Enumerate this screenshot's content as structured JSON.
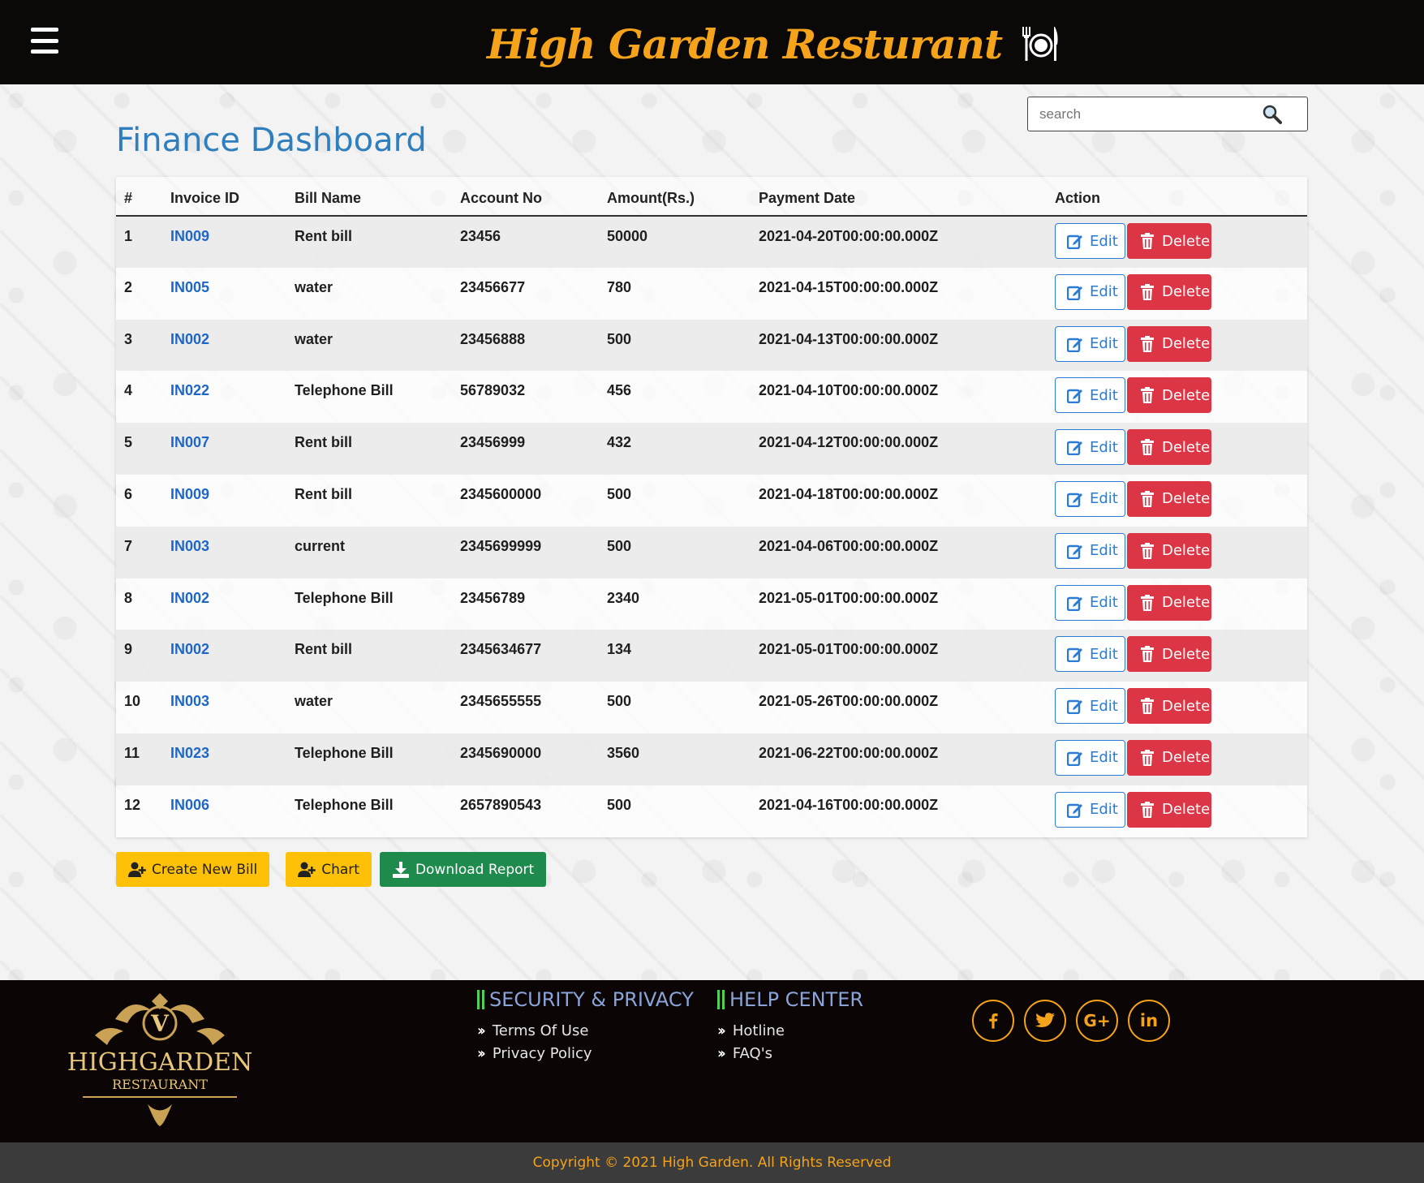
{
  "header": {
    "brand_title": "High Garden Resturant"
  },
  "search": {
    "placeholder": "search"
  },
  "page_title": "Finance Dashboard",
  "table": {
    "columns": [
      "#",
      "Invoice ID",
      "Bill Name",
      "Account No",
      "Amount(Rs.)",
      "Payment Date",
      "Action"
    ],
    "rows": [
      {
        "n": "1",
        "invoice": "IN009",
        "bill": "Rent bill",
        "account": "23456",
        "amount": "50000",
        "date": "2021-04-20T00:00:00.000Z"
      },
      {
        "n": "2",
        "invoice": "IN005",
        "bill": "water",
        "account": "23456677",
        "amount": "780",
        "date": "2021-04-15T00:00:00.000Z"
      },
      {
        "n": "3",
        "invoice": "IN002",
        "bill": "water",
        "account": "23456888",
        "amount": "500",
        "date": "2021-04-13T00:00:00.000Z"
      },
      {
        "n": "4",
        "invoice": "IN022",
        "bill": "Telephone Bill",
        "account": "56789032",
        "amount": "456",
        "date": "2021-04-10T00:00:00.000Z"
      },
      {
        "n": "5",
        "invoice": "IN007",
        "bill": "Rent bill",
        "account": "23456999",
        "amount": "432",
        "date": "2021-04-12T00:00:00.000Z"
      },
      {
        "n": "6",
        "invoice": "IN009",
        "bill": "Rent bill",
        "account": "2345600000",
        "amount": "500",
        "date": "2021-04-18T00:00:00.000Z"
      },
      {
        "n": "7",
        "invoice": "IN003",
        "bill": "current",
        "account": "2345699999",
        "amount": "500",
        "date": "2021-04-06T00:00:00.000Z"
      },
      {
        "n": "8",
        "invoice": "IN002",
        "bill": "Telephone Bill",
        "account": "23456789",
        "amount": "2340",
        "date": "2021-05-01T00:00:00.000Z"
      },
      {
        "n": "9",
        "invoice": "IN002",
        "bill": "Rent bill",
        "account": "2345634677",
        "amount": "134",
        "date": "2021-05-01T00:00:00.000Z"
      },
      {
        "n": "10",
        "invoice": "IN003",
        "bill": "water",
        "account": "2345655555",
        "amount": "500",
        "date": "2021-05-26T00:00:00.000Z"
      },
      {
        "n": "11",
        "invoice": "IN023",
        "bill": "Telephone Bill",
        "account": "2345690000",
        "amount": "3560",
        "date": "2021-06-22T00:00:00.000Z"
      },
      {
        "n": "12",
        "invoice": "IN006",
        "bill": "Telephone Bill",
        "account": "2657890543",
        "amount": "500",
        "date": "2021-04-16T00:00:00.000Z"
      }
    ],
    "edit_label": "Edit",
    "delete_label": "Delete"
  },
  "actions": {
    "create_label": "Create New Bill",
    "chart_label": "Chart",
    "download_label": "Download Report"
  },
  "footer": {
    "logo_initial": "V",
    "logo_name": "HIGHGARDEN",
    "logo_sub": "RESTAURANT",
    "security": {
      "title": "SECURITY & PRIVACY",
      "links": [
        "Terms Of Use",
        "Privacy Policy"
      ]
    },
    "help": {
      "title": "HELP CENTER",
      "links": [
        "Hotline",
        "FAQ's"
      ]
    },
    "social": [
      "facebook-icon",
      "twitter-icon",
      "google-plus-icon",
      "linkedin-icon"
    ],
    "copyright": "Copyright © 2021 High Garden. All Rights Reserved"
  },
  "colors": {
    "brand_orange": "#f5a31a",
    "link_blue": "#1f66c9",
    "delete_red": "#dc3545",
    "download_green": "#1e8a4c",
    "action_yellow": "#ffc107"
  }
}
